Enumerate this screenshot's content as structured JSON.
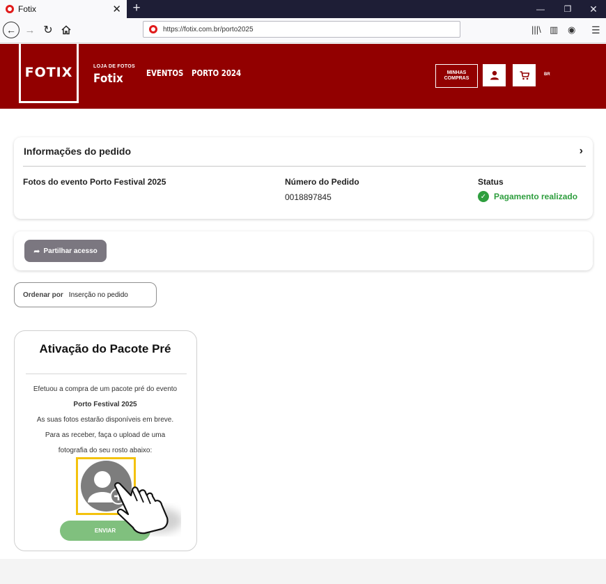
{
  "browser": {
    "tab_title": "Fotix",
    "new_tab": "+",
    "url": "https://fotix.com.br/porto2025"
  },
  "header": {
    "logo": "FOTIX",
    "store_label": "LOJA DE FOTOS",
    "store_name": "Fotix",
    "nav": [
      "EVENTOS",
      "PORTO 2024"
    ],
    "my_purchases": "MINHAS COMPRAS",
    "lang": "BR"
  },
  "order": {
    "section_title": "Informações do pedido",
    "event_label": "Fotos do evento Porto Festival 2025",
    "number_label": "Número do Pedido",
    "number_value": "0018897845",
    "status_label": "Status",
    "status_value": "Pagamento realizado",
    "status_color": "#2e9e3e"
  },
  "share": {
    "label": "Partilhar acesso"
  },
  "sort": {
    "label": "Ordenar por",
    "value": "Inserção no pedido"
  },
  "activation": {
    "title": "Ativação do Pacote Pré",
    "line1": "Efetuou a compra de um pacote pré do evento",
    "line2": "Porto Festival 2025",
    "line3": "As suas fotos estarão disponíveis em breve.",
    "line4": "Para as receber, faça o upload de uma",
    "line5": "fotografia do seu rosto abaixo:",
    "submit": "ENVIAR"
  },
  "colors": {
    "brand": "#920000",
    "accent_frame": "#f4c20d",
    "submit": "#80c07e"
  }
}
